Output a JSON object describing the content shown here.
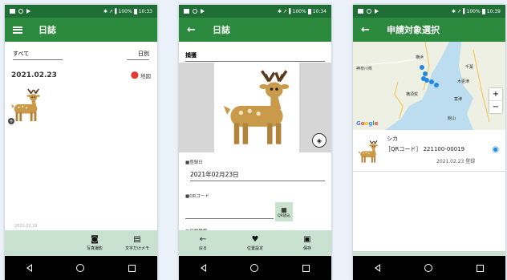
{
  "status_bar": {
    "time_1": "10:33",
    "time_2": "10:34",
    "time_3": "10:39",
    "signal": "✱ ↗▐",
    "battery": "100%"
  },
  "screen1": {
    "title": "日誌",
    "filter_all": "すべて",
    "filter_date": "日別",
    "entry_date": "2021.02.23",
    "map_link": "地図",
    "faint_text": "2021.02.22",
    "actions": [
      {
        "icon": "camera-plus-icon",
        "label": "写真撮影"
      },
      {
        "icon": "memo-plus-icon",
        "label": "文字だけメモ"
      }
    ]
  },
  "screen2": {
    "title": "日誌",
    "capture": "捕獲",
    "date_label": "■登録日",
    "date_value": "2021年02月23日",
    "qr_label": "■QRコード",
    "qr_button": "QR読込",
    "species_label": "■鳥獣種類",
    "actions": [
      {
        "icon": "arrow-left-icon",
        "label": "戻る"
      },
      {
        "icon": "location-plus-icon",
        "label": "位置設定"
      },
      {
        "icon": "save-icon",
        "label": "保存"
      }
    ]
  },
  "screen3": {
    "title": "申請対象選択",
    "map_labels": {
      "kanagawa": "神奈川県",
      "yokohama": "横浜",
      "yokosuka": "横須賀",
      "chiba": "千葉",
      "kisarazu": "木更津",
      "futtsu": "富津",
      "tateyama": "館山"
    },
    "google": "Google",
    "zoom_in": "+",
    "zoom_out": "−",
    "result": {
      "name": "シカ",
      "qr": "［QRコード］ 221100-00019",
      "date": "2021.02.23 登録"
    }
  },
  "colors": {
    "status_bar": "#1e6e35",
    "app_bar": "#2b8a3e",
    "action_bar": "#c9e1cf",
    "pin_red": "#e53935",
    "pin_blue": "#1e88e5"
  }
}
